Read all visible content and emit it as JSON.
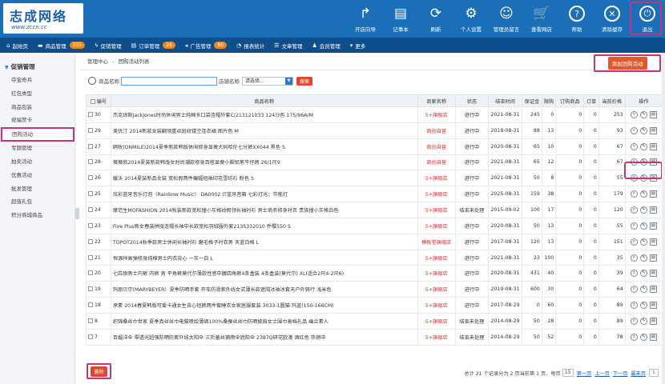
{
  "logo": {
    "main": "志成网络",
    "sub": "www.zccn.cc"
  },
  "topnav": [
    {
      "label": "开店向导",
      "icon": "share-icon",
      "glyph": "↱"
    },
    {
      "label": "记事本",
      "icon": "notepad-icon",
      "glyph": "▤"
    },
    {
      "label": "刷新",
      "icon": "refresh-icon",
      "glyph": "⟳"
    },
    {
      "label": "个人设置",
      "icon": "person-settings-icon",
      "glyph": "⚙"
    },
    {
      "label": "管理员留言",
      "icon": "message-icon",
      "glyph": "☺"
    },
    {
      "label": "查看网店",
      "icon": "cart-icon",
      "glyph": "🛒"
    },
    {
      "label": "帮助",
      "icon": "help-icon",
      "glyph": "?"
    },
    {
      "label": "清除缓存",
      "icon": "clear-cache-icon",
      "glyph": "✕"
    },
    {
      "label": "退出",
      "icon": "power-icon",
      "glyph": "⏻"
    }
  ],
  "menubar": [
    {
      "label": "起始页",
      "icon": "home-icon",
      "glyph": "⌂"
    },
    {
      "label": "商品管理",
      "icon": "folder-icon",
      "glyph": "▬",
      "badge": "225"
    },
    {
      "label": "促销管理",
      "icon": "promo-icon",
      "glyph": "ϟ"
    },
    {
      "label": "订单管理",
      "icon": "order-icon",
      "glyph": "▤",
      "badge": "26"
    },
    {
      "label": "广告管理",
      "icon": "ad-icon",
      "glyph": "◂",
      "badge": "80"
    },
    {
      "label": "报表统计",
      "icon": "report-icon",
      "glyph": "◔"
    },
    {
      "label": "文章管理",
      "icon": "article-icon",
      "glyph": "☰"
    },
    {
      "label": "会员管理",
      "icon": "member-icon",
      "glyph": "♟"
    },
    {
      "label": "更多",
      "icon": "more-icon",
      "glyph": "▾"
    }
  ],
  "sidebar": {
    "heading": "促销管理",
    "items": [
      "夺宝奇兵",
      "红包类型",
      "商品包装",
      "祝福贺卡",
      "团购活动",
      "专题管理",
      "拍卖活动",
      "优惠活动",
      "批发管理",
      "超值礼包",
      "积分商城商品"
    ]
  },
  "breadcrumb": {
    "a": "管理中心",
    "sep": "-",
    "b": "团购活动列表"
  },
  "add_button": "添加团购活动",
  "search": {
    "goods_label": "商品名称",
    "shop_label": "店铺名称",
    "shop_select": "请选择...",
    "button": "搜索"
  },
  "columns": [
    "编号",
    "商品名称",
    "商家名称",
    "状态",
    "结束时间",
    "保证金",
    "限购",
    "订购商品",
    "订单",
    "当前价格",
    "操作"
  ],
  "rows": [
    {
      "id": "30",
      "name": "杰克琼斯JackJones时尚休闲男士纯棉多口袋连帽外套C|213121033 124沙色 175/96A/M",
      "shop": "5+旗舰店",
      "status": "进行中",
      "end": "2021-08-31",
      "deposit": "245",
      "limit": "0",
      "goods": "0",
      "orders": "0",
      "price": "253"
    },
    {
      "id": "29",
      "name": "美优汀 2014新款女装翻领重丝斑纹镂空连衣裙 图片色 M",
      "shop": "商创自营",
      "status": "进行中",
      "end": "2018-08-31",
      "deposit": "88",
      "limit": "13",
      "goods": "0",
      "orders": "0",
      "price": "93"
    },
    {
      "id": "27",
      "name": "鸥牧(ONMILE)2014夏季新款韩版休闲修身显瘦大码哈伦七分裤XX044 黑色 S",
      "shop": "商创自营",
      "status": "进行中",
      "end": "2020-08-31",
      "deposit": "65",
      "limit": "10",
      "goods": "0",
      "orders": "0",
      "price": "67"
    },
    {
      "id": "28",
      "name": "薇薇依2014夏装新款韩版女时尚潮款修身百搭显瘦小脚铅笔牛仔裤 26/1尺9",
      "shop": "商创自营",
      "status": "进行中",
      "end": "2021-08-31",
      "deposit": "65",
      "limit": "12",
      "goods": "0",
      "orders": "0",
      "price": "67"
    },
    {
      "id": "26",
      "name": "媛沃 2014夏装新品女装 宽松假两件蝙蝠短袖印花雪纺衫 粉色 S",
      "shop": "5+旗舰店",
      "status": "进行中",
      "end": "2021-08-31",
      "deposit": "50",
      "limit": "8",
      "goods": "0",
      "orders": "0",
      "price": "55"
    },
    {
      "id": "25",
      "name": "炫彩蓝牙音乐灯泡（Rainbow Music） DA0002 IT蓝牙音箱 七彩灯光；节能灯",
      "shop": "5+旗舰店",
      "status": "进行中",
      "end": "2025-08-31",
      "deposit": "159",
      "limit": "38",
      "goods": "0",
      "orders": "0",
      "price": "179"
    },
    {
      "id": "24",
      "name": "摩范生MOFASHION 2014秋装新款宽松撞小灰格纹假领长袖衬衫 男士商务修身衬衣 贵族撞小灰格白色",
      "shop": "5+旗舰店",
      "status": "结束未处理",
      "end": "2015-09-02",
      "deposit": "100",
      "limit": "17",
      "goods": "0",
      "orders": "0",
      "price": "120"
    },
    {
      "id": "23",
      "name": "Five Plus新女春装拼接连帽长袖中长款宽松羽绒服外套2135332010 乔樱550 S",
      "shop": "5+旗舰店",
      "status": "进行中",
      "end": "2020-08-31",
      "deposit": "50",
      "limit": "13",
      "goods": "0",
      "orders": "0",
      "price": "55"
    },
    {
      "id": "22",
      "name": "TOPOT2014秋季款男士休闲长袖衬衫 磨毛格子衬衣男 天蓝白格 L",
      "shop": "模板堂旗舰店",
      "status": "进行中",
      "end": "2017-08-31",
      "deposit": "120",
      "limit": "13",
      "goods": "0",
      "orders": "0",
      "price": "151"
    },
    {
      "id": "21",
      "name": "恒源祥高弹修身纯棉男士内衣背心 一灰一白 L",
      "shop": "5+旗舰店",
      "status": "进行中",
      "end": "2021-08-31",
      "deposit": "23",
      "limit": "100",
      "goods": "0",
      "orders": "0",
      "price": "35"
    },
    {
      "id": "20",
      "name": "七匹狼男士内裤 内裤 男 平角裤莫代尔薄款性感中腰四角裤4条盒装 4条盒装(莫代尔) XL(适合2尺4-2尺6)",
      "shop": "5+旗舰店",
      "status": "进行中",
      "end": "2020-08-31",
      "deposit": "431",
      "limit": "40",
      "goods": "0",
      "orders": "0",
      "price": "39"
    },
    {
      "id": "19",
      "name": "玛丽贝尔(MARYBEYER）夏季防晒手套 开车防滑紫外线女式薄长款遮阳冰袖冰套天户外骑行 浅米色",
      "shop": "5+旗舰店",
      "status": "进行中",
      "end": "2019-08-31",
      "deposit": "600",
      "limit": "30",
      "goods": "0",
      "orders": "0",
      "price": "64"
    },
    {
      "id": "18",
      "name": "承素 2014春夏韩版可爱卡通女生背心短裤两件套睡衣女家居服套装 3033-1圆猫 玛蓝(150-166CM)",
      "shop": "5+旗舰店",
      "status": "进行中",
      "end": "2017-08-29",
      "deposit": "0",
      "limit": "60",
      "goods": "0",
      "orders": "0",
      "price": "89"
    },
    {
      "id": "8",
      "name": "织锦桑丝巾世家 夏季真丝丝巾电脑喷绘薄绸100%桑蚕丝丝巾防晒披肩女士围巾高档礼品 幽兰素人",
      "shop": "5+旗舰店",
      "status": "结束未处理",
      "end": "2014-08-29",
      "deposit": "50",
      "limit": "28",
      "goods": "0",
      "orders": "0",
      "price": "89"
    },
    {
      "id": "7",
      "name": "百媚洋伞 零透光超强防晒防紫外线太阳伞 三折童丝捕雨伞遮阳伞 2387Q研花欧澳 酒红色 热销中",
      "shop": "5+旗舰店",
      "status": "结束未处理",
      "end": "2014-08-29",
      "deposit": "50",
      "limit": "52",
      "goods": "0",
      "orders": "0",
      "price": "78"
    }
  ],
  "delete_button": "删除",
  "pager": {
    "summary": "总计 21 个记录分为 2 页当前第 1 页，每页",
    "per_page": "15",
    "first": "第一页",
    "prev": "上一页",
    "next": "下一页",
    "last": "最末页",
    "page": "1"
  },
  "colors": {
    "top": "#1a6fb8",
    "menubar": "#0f4e8c",
    "accent": "#e4562b",
    "highlight": "#c8327a",
    "shop_red": "#e02828"
  }
}
